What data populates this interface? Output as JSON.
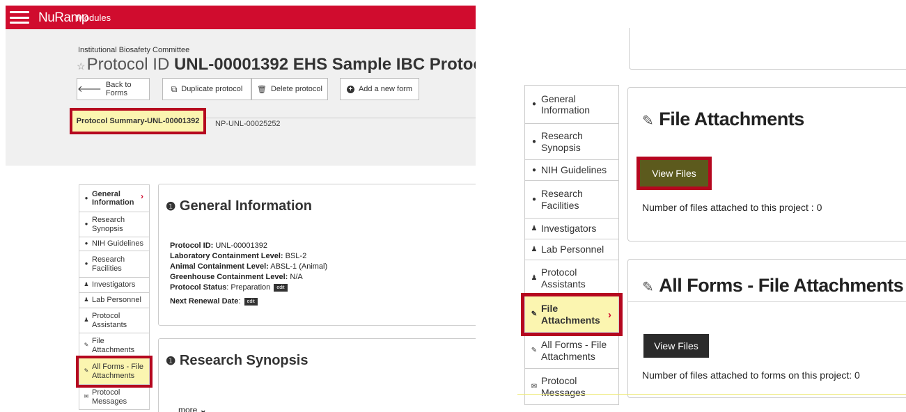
{
  "left": {
    "topbar": {
      "brand": "NuRamp",
      "modules": "Modules"
    },
    "header": {
      "committee": "Institutional Biosafety Committee",
      "title_prefix": "Protocol ID ",
      "title_bold": "UNL-00001392",
      "title_suffix": " EHS Sample IBC Protocol"
    },
    "buttons": {
      "back": "Back to Forms",
      "duplicate": "Duplicate protocol",
      "delete": "Delete protocol",
      "add": "Add a new form"
    },
    "summary_tab": "Protocol Summary-UNL-00001392",
    "np_id": "NP-UNL-00025252",
    "nav": [
      {
        "label": "General Information",
        "icon": "info-icon"
      },
      {
        "label": "Research Synopsis",
        "icon": "info-icon"
      },
      {
        "label": "NIH Guidelines",
        "icon": "info-icon"
      },
      {
        "label": "Research Facilities",
        "icon": "info-icon"
      },
      {
        "label": "Investigators",
        "icon": "users-icon"
      },
      {
        "label": "Lab Personnel",
        "icon": "users-icon"
      },
      {
        "label": "Protocol Assistants",
        "icon": "users-icon"
      },
      {
        "label": "File Attachments",
        "icon": "paperclip-icon"
      },
      {
        "label": "All Forms - File Attachments",
        "icon": "paperclip-icon"
      },
      {
        "label": "Protocol Messages",
        "icon": "envelope-icon"
      }
    ],
    "general_info": {
      "title": "General Information",
      "protocol_id_label": "Protocol ID:",
      "protocol_id": " UNL-00001392",
      "lab_label": "Laboratory Containment Level:",
      "lab": " BSL-2",
      "animal_label": "Animal Containment Level:",
      "animal": " ABSL-1 (Animal)",
      "greenhouse_label": "Greenhouse Containment Level:",
      "greenhouse": " N/A",
      "status_label": "Protocol Status",
      "status": ": Preparation",
      "renewal_label": "Next Renewal Date",
      "renewal": ":",
      "edit": "edit"
    },
    "research_synopsis": {
      "title": "Research Synopsis",
      "more": "more"
    }
  },
  "right": {
    "nav": [
      {
        "label": "General Information",
        "icon": "info-icon"
      },
      {
        "label": "Research Synopsis",
        "icon": "info-icon"
      },
      {
        "label": "NIH Guidelines",
        "icon": "info-icon"
      },
      {
        "label": "Research Facilities",
        "icon": "info-icon"
      },
      {
        "label": "Investigators",
        "icon": "users-icon"
      },
      {
        "label": "Lab Personnel",
        "icon": "users-icon"
      },
      {
        "label": "Protocol Assistants",
        "icon": "users-icon"
      },
      {
        "label": "File Attachments",
        "icon": "paperclip-icon"
      },
      {
        "label": "All Forms - File Attachments",
        "icon": "paperclip-icon"
      },
      {
        "label": "Protocol Messages",
        "icon": "envelope-icon"
      }
    ],
    "file_attachments": {
      "title": "File Attachments",
      "button": "View Files",
      "count_text": "Number of files attached to this project : 0"
    },
    "all_forms": {
      "title": "All Forms - File Attachments",
      "button": "View Files",
      "count_text": "Number of files attached to forms on this project: 0"
    }
  },
  "colors": {
    "brand_red": "#d00c2e",
    "highlight_border": "#b5071f",
    "highlight_fill": "#fbf5b0",
    "olive_button": "#5c5a1d",
    "dark_button": "#2b2b2b"
  }
}
